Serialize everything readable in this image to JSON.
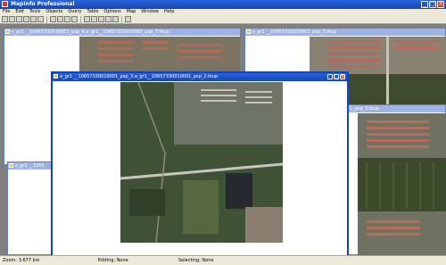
{
  "app": {
    "title": "MapInfo Professional"
  },
  "menu": [
    "File",
    "Edit",
    "Tools",
    "Objects",
    "Query",
    "Table",
    "Options",
    "Map",
    "Window",
    "Help"
  ],
  "windows": {
    "back_left_title": "s_gr1 __10657330010001_psp_4.a_gr1__10657330010001_psp_7.tkup",
    "back_right_title": "s_gr1 __10657330010001_psp_3.tkup",
    "lower_left_title": "s_gr1 __1065",
    "right_partial_title": "01_psp_3.tkup",
    "active_title": "a_gr1 __10657330010001_psp_3.a_gr1__10657330010001_psp_2.tkup"
  },
  "status": {
    "zoom": "Zoom: 3.677 km",
    "editing": "Editing: None",
    "selecting": "Selecting: None"
  },
  "colors": {
    "titlebar": "#1446b8",
    "inactive_title": "#9db3e6"
  }
}
